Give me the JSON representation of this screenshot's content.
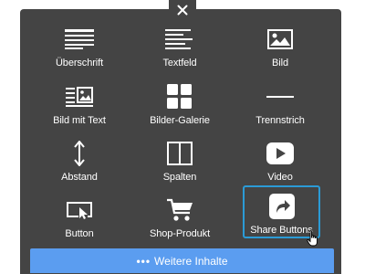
{
  "close_button": {
    "icon": "close-icon",
    "symbol": "✕"
  },
  "tiles": [
    {
      "label": "Überschrift",
      "icon": "heading-icon"
    },
    {
      "label": "Textfeld",
      "icon": "text-field-icon"
    },
    {
      "label": "Bild",
      "icon": "image-icon"
    },
    {
      "label": "Bild mit Text",
      "icon": "image-with-text-icon"
    },
    {
      "label": "Bilder-Galerie",
      "icon": "gallery-grid-icon"
    },
    {
      "label": "Trennstrich",
      "icon": "divider-line-icon"
    },
    {
      "label": "Abstand",
      "icon": "vertical-spacing-icon"
    },
    {
      "label": "Spalten",
      "icon": "columns-icon"
    },
    {
      "label": "Video",
      "icon": "video-play-icon"
    },
    {
      "label": "Button",
      "icon": "button-pointer-icon"
    },
    {
      "label": "Shop-Produkt",
      "icon": "shopping-cart-icon"
    },
    {
      "label": "Share Buttons",
      "icon": "share-arrow-icon",
      "selected": true
    }
  ],
  "more_button": {
    "dots": "•••",
    "label": "Weitere Inhalte"
  },
  "colors": {
    "panel_bg": "#444444",
    "selection_border": "#2b9bd6",
    "more_bar_bg": "#5b9df0",
    "icon_fg": "#ffffff"
  }
}
